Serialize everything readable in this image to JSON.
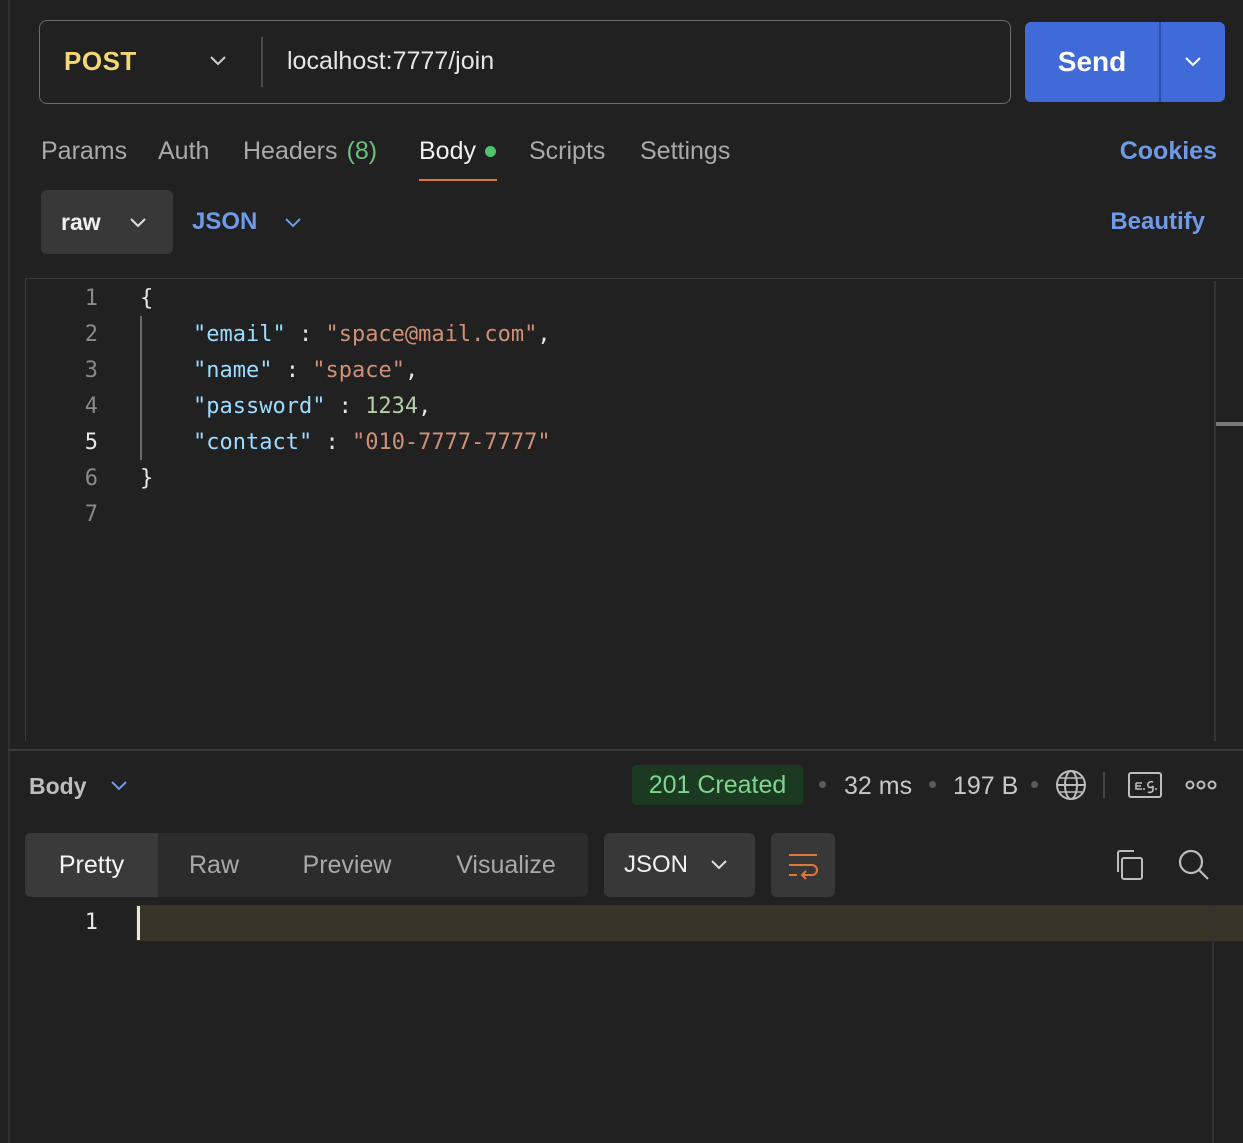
{
  "request": {
    "method": "POST",
    "url": "localhost:7777/join",
    "send_label": "Send"
  },
  "tabs": [
    {
      "label": "Params"
    },
    {
      "label": "Auth"
    },
    {
      "label": "Headers",
      "count": "(8)"
    },
    {
      "label": "Body",
      "active": true
    },
    {
      "label": "Scripts"
    },
    {
      "label": "Settings"
    }
  ],
  "cookies_label": "Cookies",
  "body_mode": {
    "raw_label": "raw",
    "format_label": "JSON",
    "beautify_label": "Beautify"
  },
  "editor": {
    "line_numbers": [
      "1",
      "2",
      "3",
      "4",
      "5",
      "6",
      "7"
    ],
    "lines": {
      "l1": "{",
      "email_key": "\"email\"",
      "email_value": "\"space@mail.com\"",
      "name_key": "\"name\"",
      "name_value": "\"space\"",
      "password_key": "\"password\"",
      "password_value": "1234",
      "contact_key": "\"contact\"",
      "contact_value": "\"010-7777-7777\"",
      "l6": "}"
    },
    "current_line": "5"
  },
  "response": {
    "body_label": "Body",
    "status": "201 Created",
    "time": "32 ms",
    "size": "197 B",
    "view_tabs": [
      "Pretty",
      "Raw",
      "Preview",
      "Visualize"
    ],
    "format_label": "JSON",
    "line_number": "1"
  },
  "colors": {
    "accent": "#3f6ad8",
    "method": "#f2d774",
    "link": "#6f9ae8",
    "status_green": "#7ed58d",
    "active_tab_underline": "#e0763a"
  }
}
